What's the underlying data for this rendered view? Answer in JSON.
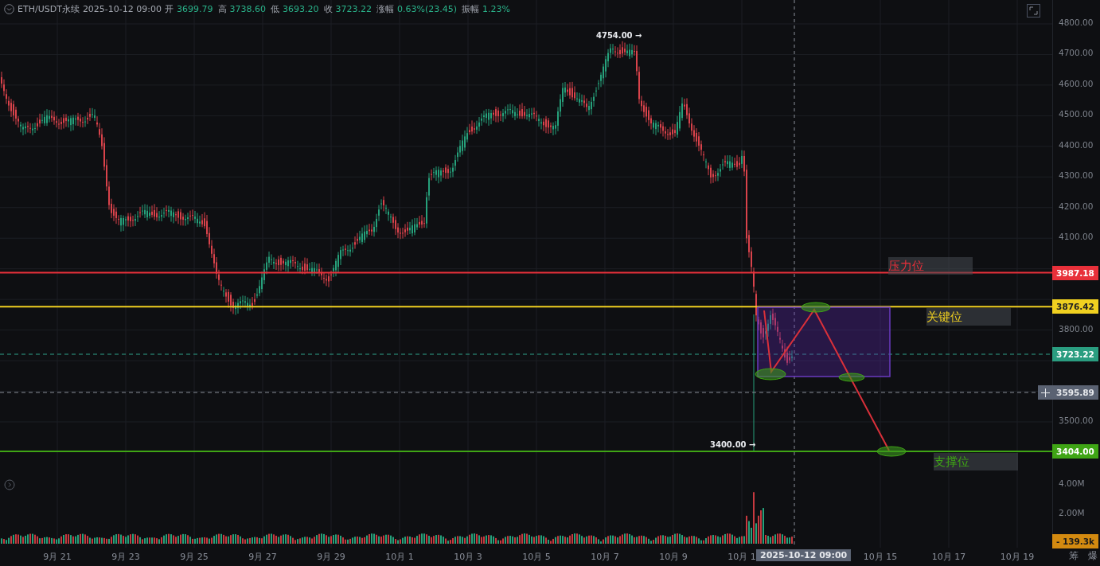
{
  "header": {
    "symbol": "ETH/USDT永续",
    "datetime": "2025-10-12 09:00",
    "fields": [
      {
        "label": "开",
        "value": "3699.79"
      },
      {
        "label": "高",
        "value": "3738.60"
      },
      {
        "label": "低",
        "value": "3693.20"
      },
      {
        "label": "收",
        "value": "3723.22"
      },
      {
        "label": "涨幅",
        "value": "0.63%(23.45)"
      },
      {
        "label": "振幅",
        "value": "1.23%"
      }
    ]
  },
  "price_axis": [
    "4800.00",
    "4700.00",
    "4600.00",
    "4500.00",
    "4400.00",
    "4300.00",
    "4200.00",
    "4100.00",
    "3800.00",
    "3500.00"
  ],
  "levels": [
    {
      "kind": "resistance",
      "label": "压力位",
      "price": "3987.18",
      "color": "#e8303a"
    },
    {
      "kind": "key",
      "label": "关键位",
      "price": "3876.42",
      "color": "#f0d020"
    },
    {
      "kind": "support",
      "label": "支撑位",
      "price": "3404.00",
      "color": "#3fa515"
    }
  ],
  "current_price": "3723.22",
  "crosshair_price": "3595.89",
  "crosshair_time": "2025-10-12 09:00",
  "high_marker": "4754.00 →",
  "low_marker": "3400.00 →",
  "volume_axis": [
    "4.00M",
    "2.00M"
  ],
  "volume_badge": "- 139.3k",
  "time_axis": [
    "9月 21",
    "9月 23",
    "9月 25",
    "9月 27",
    "9月 29",
    "10月 1",
    "10月 3",
    "10月 5",
    "10月 7",
    "10月 9",
    "10月 1",
    "10月 15",
    "10月 17",
    "10月 19"
  ],
  "corner_buttons": [
    "筹",
    "爆"
  ]
}
